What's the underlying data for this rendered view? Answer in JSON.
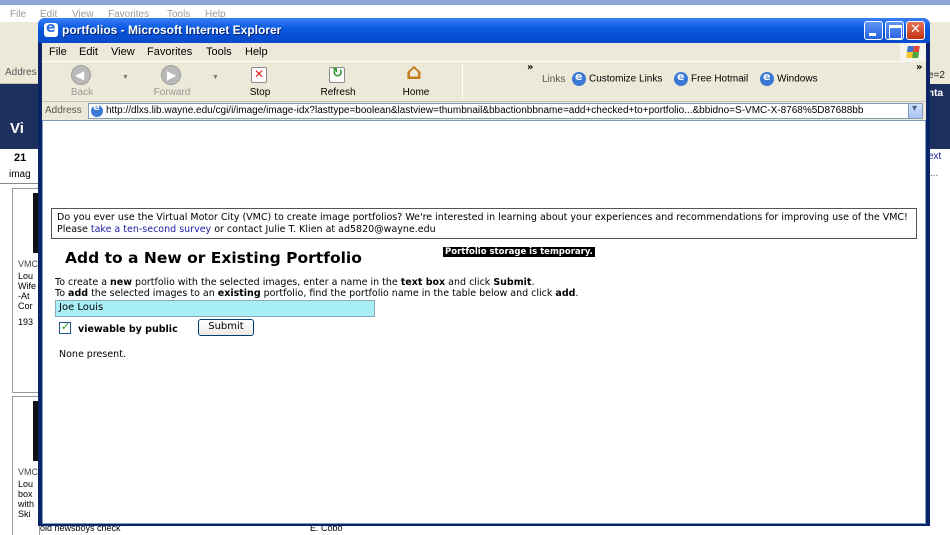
{
  "background": {
    "menu": [
      "File",
      "Edit",
      "View",
      "Favorites",
      "Tools",
      "Help"
    ],
    "left_fragments": [
      "Addres",
      "Vi",
      "21",
      "imag",
      "VMC",
      "Lou",
      "Wife",
      "-At",
      "Cor",
      "193",
      "VMC",
      "Lou",
      "box",
      "with",
      "Ski",
      "old newsboys check"
    ],
    "right_fragments": [
      "e=2",
      "nta",
      "ext",
      "..."
    ],
    "bottom_fragments": [
      "E. Cobo"
    ]
  },
  "window": {
    "title": "portfolios - Microsoft Internet Explorer"
  },
  "menubar": [
    "File",
    "Edit",
    "View",
    "Favorites",
    "Tools",
    "Help"
  ],
  "toolbar": {
    "back": "Back",
    "forward": "Forward",
    "stop": "Stop",
    "refresh": "Refresh",
    "home": "Home",
    "chevron": "»",
    "links_label": "Links",
    "links": [
      "Customize Links",
      "Free Hotmail",
      "Windows"
    ]
  },
  "address": {
    "label": "Address",
    "url": "http://dlxs.lib.wayne.edu/cgi/i/image/image-idx?lasttype=boolean&lastview=thumbnail&bbactionbbname=add+checked+to+portfolio...&bbidno=S-VMC-X-8768%5D87688bb"
  },
  "page": {
    "survey_text_1": "Do you ever use the Virtual Motor City (VMC) to create image portfolios? We're interested in learning about your experiences and recommendations for improving use of the VMC! Please ",
    "survey_link": "take a ten-second survey",
    "survey_text_2": " or contact Julie T. Klien at ad5820@wayne.edu",
    "storage_notice": "Portfolio storage is temporary.",
    "heading": "Add to a New or Existing Portfolio",
    "instr1_a": "To create a ",
    "instr1_b": "new",
    "instr1_c": " portfolio with the selected images, enter a name in the ",
    "instr1_d": "text box",
    "instr1_e": " and click ",
    "instr1_f": "Submit",
    "instr1_g": ".",
    "instr2_a": "To ",
    "instr2_b": "add",
    "instr2_c": " the selected images to an ",
    "instr2_d": "existing",
    "instr2_e": " portfolio, find the portfolio name in the table below and click ",
    "instr2_f": "add",
    "instr2_g": ".",
    "portfolio_name": "Joe Louis",
    "public_checked": true,
    "public_label": "viewable by public",
    "submit_label": "Submit",
    "none_present": "None present."
  }
}
